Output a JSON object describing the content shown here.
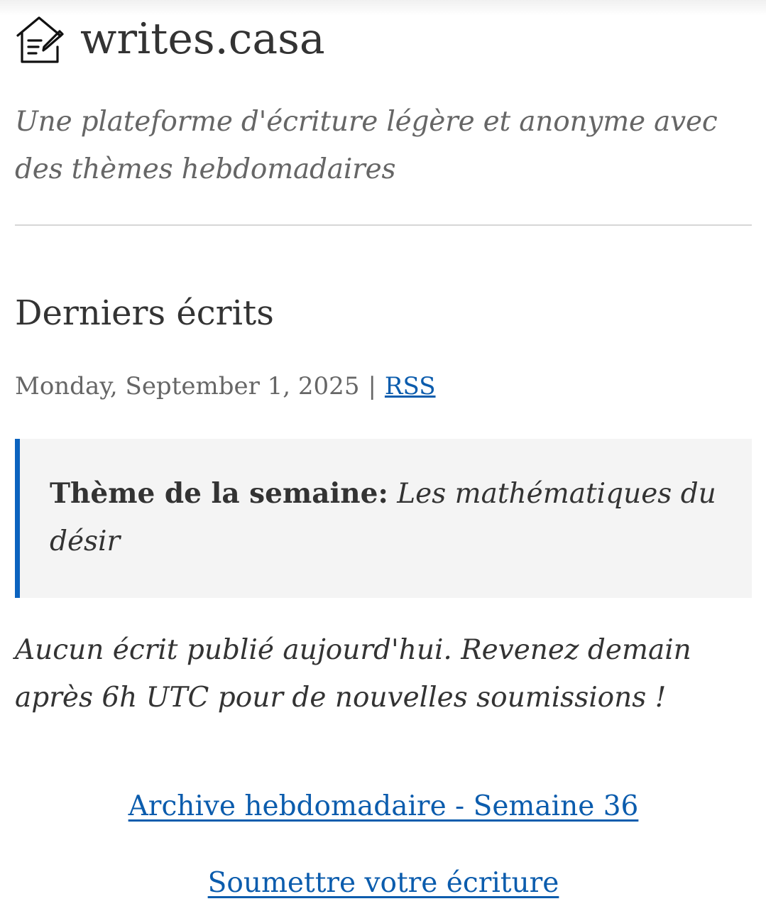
{
  "site": {
    "title": "writes.casa",
    "tagline": "Une plateforme d'écriture légère et anonyme avec des thèmes hebdomadaires",
    "logo_icon": "house-edit-icon"
  },
  "feed": {
    "heading": "Derniers écrits",
    "date": "Monday, September 1, 2025",
    "separator": "|",
    "rss_label": "RSS"
  },
  "theme": {
    "label": "Thème de la semaine:",
    "value": "Les mathématiques du désir"
  },
  "empty_message": "Aucun écrit publié aujourd'hui. Revenez demain après 6h UTC pour de nouvelles soumissions !",
  "links": {
    "archive": "Archive hebdomadaire - Semaine 36",
    "submit": "Soumettre votre écriture"
  },
  "colors": {
    "link": "#0b5cad",
    "accent_border": "#0b63bf",
    "theme_bg": "#f4f4f4",
    "text": "#333333",
    "muted": "#666666"
  }
}
